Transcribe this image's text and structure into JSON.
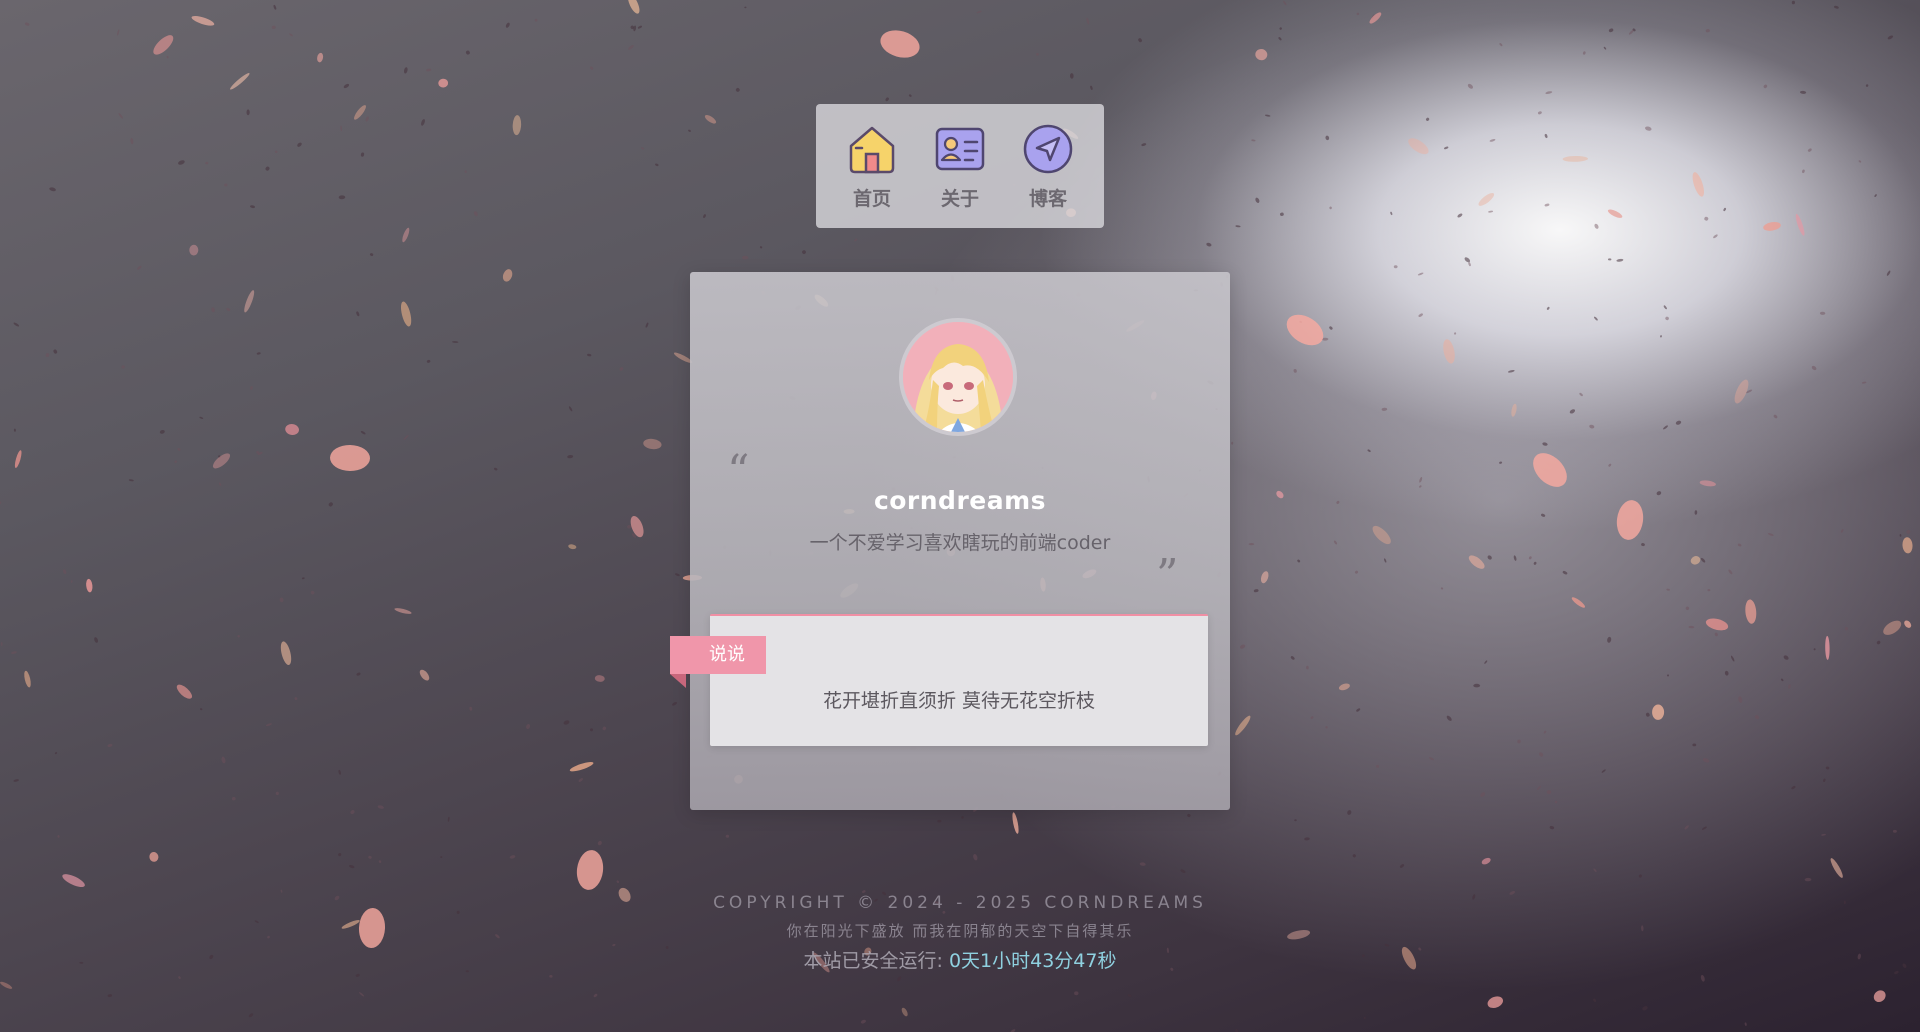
{
  "nav": {
    "items": [
      {
        "label": "首页",
        "icon": "home-icon"
      },
      {
        "label": "关于",
        "icon": "profile-card-icon"
      },
      {
        "label": "博客",
        "icon": "navigation-arrow-icon"
      }
    ]
  },
  "profile": {
    "name": "corndreams",
    "bio": "一个不爱学习喜欢瞎玩的前端coder",
    "quote_open": "“",
    "quote_close": "”"
  },
  "shuoshuo": {
    "tag": "说说",
    "text": "花开堪折直须折 莫待无花空折枝"
  },
  "footer": {
    "copyright": "COPYRIGHT © 2024 - 2025 CORNDREAMS",
    "motto": "你在阳光下盛放 而我在阴郁的天空下自得其乐",
    "runtime_label": "本站已安全运行: ",
    "runtime_value": "0天1小时43分47秒"
  },
  "colors": {
    "accent_pink": "#f096aa",
    "runtime_cyan": "#8fd1e0"
  }
}
